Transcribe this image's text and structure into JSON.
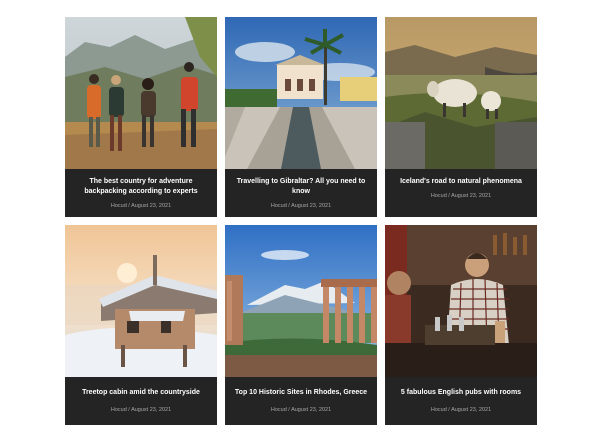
{
  "posts": [
    {
      "title": "The best country for adventure backpacking according to experts",
      "author": "Hocud",
      "separator": "/",
      "date": "August 23, 2021",
      "image": "backpackers-hiking"
    },
    {
      "title": "Travelling to Gibraltar? All you need to know",
      "author": "Hocud",
      "separator": "/",
      "date": "August 23, 2021",
      "image": "palm-garden-villa"
    },
    {
      "title": "Iceland's road to natural phenomena",
      "author": "Hocud",
      "separator": "/",
      "date": "August 23, 2021",
      "image": "sheep-on-hill"
    },
    {
      "title": "Treetop cabin amid the countryside",
      "author": "Hocud",
      "separator": "/",
      "date": "August 23, 2021",
      "image": "snowy-cabin"
    },
    {
      "title": "Top 10 Historic Sites in Rhodes, Greece",
      "author": "Hocud",
      "separator": "/",
      "date": "August 23, 2021",
      "image": "ruins-mountain"
    },
    {
      "title": "5 fabulous English pubs with rooms",
      "author": "Hocud",
      "separator": "/",
      "date": "August 23, 2021",
      "image": "pub-bartender"
    }
  ]
}
